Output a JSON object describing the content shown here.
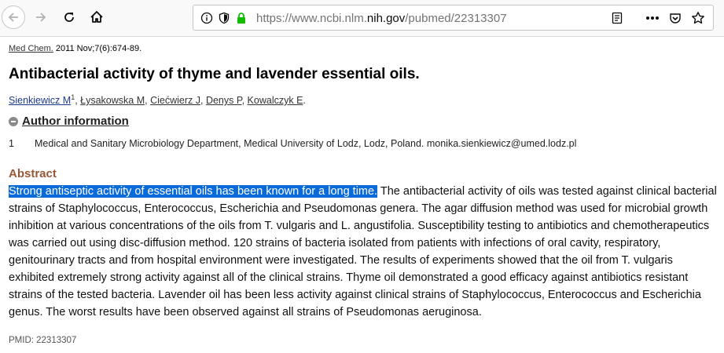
{
  "browser": {
    "url_prefix": "https://www.ncbi.nlm.",
    "url_host": "nih.gov",
    "url_suffix": "/pubmed/22313307"
  },
  "article": {
    "journal": "Med Chem.",
    "citation_rest": " 2011 Nov;7(6):674-89.",
    "title": "Antibacterial activity of thyme and lavender essential oils.",
    "authors": [
      {
        "name": "Sienkiewicz M",
        "sup": "1"
      },
      {
        "name": "Łysakowska M"
      },
      {
        "name": "Ciećwierz J"
      },
      {
        "name": "Denys P"
      },
      {
        "name": "Kowalczyk E"
      }
    ],
    "author_info_label": "Author information",
    "affiliation_num": "1",
    "affiliation_text": "Medical and Sanitary Microbiology Department, Medical University of Lodz, Lodz, Poland. monika.sienkiewicz@umed.lodz.pl",
    "abstract_label": "Abstract",
    "abstract_selected": "Strong antiseptic activity of essential oils has been known for a long time.",
    "abstract_rest": " The antibacterial activity of oils was tested against clinical bacterial strains of Staphylococcus, Enterococcus, Escherichia and Pseudomonas genera. The agar diffusion method was used for microbial growth inhibition at various concentrations of the oils from T. vulgaris and L. angustifolia. Susceptibility testing to antibiotics and chemotherapeutics was carried out using disc-diffusion method. 120 strains of bacteria isolated from patients with infections of oral cavity, respiratory, genitourinary tracts and from hospital environment were investigated. The results of experiments showed that the oil from T. vulgaris exhibited extremely strong activity against all of the clinical strains. Thyme oil demonstrated a good efficacy against antibiotics resistant strains of the tested bacteria. Lavender oil has been less activity against clinical strains of Staphylococcus, Enterococcus and Escherichia genus. The worst results have been observed against all strains of Pseudomonas aeruginosa.",
    "pmid": "PMID: 22313307"
  }
}
